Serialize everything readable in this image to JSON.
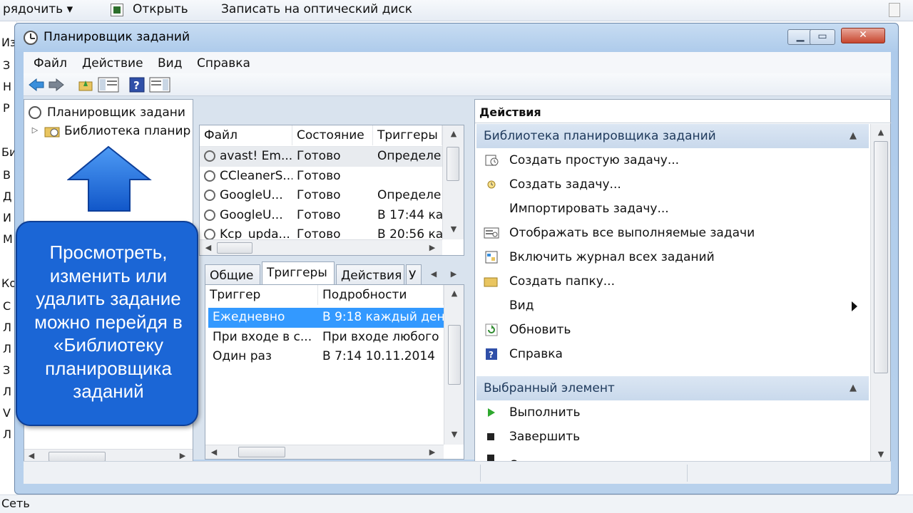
{
  "explorer": {
    "toolbar": {
      "organize": "рядочить",
      "open": "Открыть",
      "burn": "Записать на оптический диск"
    },
    "status": "Сеть",
    "left_fragments": [
      "Из",
      "З",
      "Н",
      "Р",
      "Би",
      "В",
      "Д",
      "И",
      "М",
      "Ко",
      "С",
      "Л",
      "Л",
      "З",
      "Л",
      "V",
      "Л"
    ]
  },
  "window": {
    "title": "Планировщик заданий",
    "menu": [
      "Файл",
      "Действие",
      "Вид",
      "Справка"
    ],
    "tree": {
      "root": "Планировщик задани",
      "child": "Библиотека планир"
    },
    "tasks": {
      "columns": [
        "Файл",
        "Состояние",
        "Триггеры"
      ],
      "rows": [
        {
          "name": "avast! Em...",
          "state": "Готово",
          "trigger": "Определе"
        },
        {
          "name": "CCleanerS...",
          "state": "Готово",
          "trigger": ""
        },
        {
          "name": "GoogleU...",
          "state": "Готово",
          "trigger": "Определе"
        },
        {
          "name": "GoogleU...",
          "state": "Готово",
          "trigger": "В 17:44 ка"
        },
        {
          "name": "Kcp_upda...",
          "state": "Готово",
          "trigger": "В 20:56 ка"
        }
      ]
    },
    "tabs": [
      "Общие",
      "Триггеры",
      "Действия",
      "У"
    ],
    "triggers": {
      "columns": [
        "Триггер",
        "Подробности"
      ],
      "rows": [
        {
          "type": "Ежедневно",
          "details": "В 9:18 каждый ден"
        },
        {
          "type": "При входе в с...",
          "details": "При входе любого"
        },
        {
          "type": "Один раз",
          "details": "В 7:14 10.11.2014"
        }
      ]
    },
    "actions": {
      "header": "Действия",
      "sections": [
        {
          "title": "Библиотека планировщика заданий",
          "items": [
            {
              "label": "Создать простую задачу...",
              "icon": "create-basic-task-icon"
            },
            {
              "label": "Создать задачу...",
              "icon": "create-task-icon"
            },
            {
              "label": "Импортировать задачу...",
              "icon": ""
            },
            {
              "label": "Отображать все выполняемые задачи",
              "icon": "running-tasks-icon"
            },
            {
              "label": "Включить журнал всех заданий",
              "icon": "history-icon"
            },
            {
              "label": "Создать папку...",
              "icon": "folder-icon"
            },
            {
              "label": "Вид",
              "icon": ""
            },
            {
              "label": "Обновить",
              "icon": "refresh-icon"
            },
            {
              "label": "Справка",
              "icon": "help-icon"
            }
          ]
        },
        {
          "title": "Выбранный элемент",
          "items": [
            {
              "label": "Выполнить",
              "icon": "run-icon"
            },
            {
              "label": "Завершить",
              "icon": "stop-icon"
            },
            {
              "label": "Отключить",
              "icon": "disable-icon"
            }
          ]
        }
      ]
    }
  },
  "callout": "Просмотреть, изменить или удалить задание можно перейдя в «Библиотеку планировщика заданий",
  "colors": {
    "callout_bg": "#1b66d6",
    "selection": "#3399ff",
    "section_header": "#c9d9ec",
    "window_frame": "#aecbeb"
  }
}
